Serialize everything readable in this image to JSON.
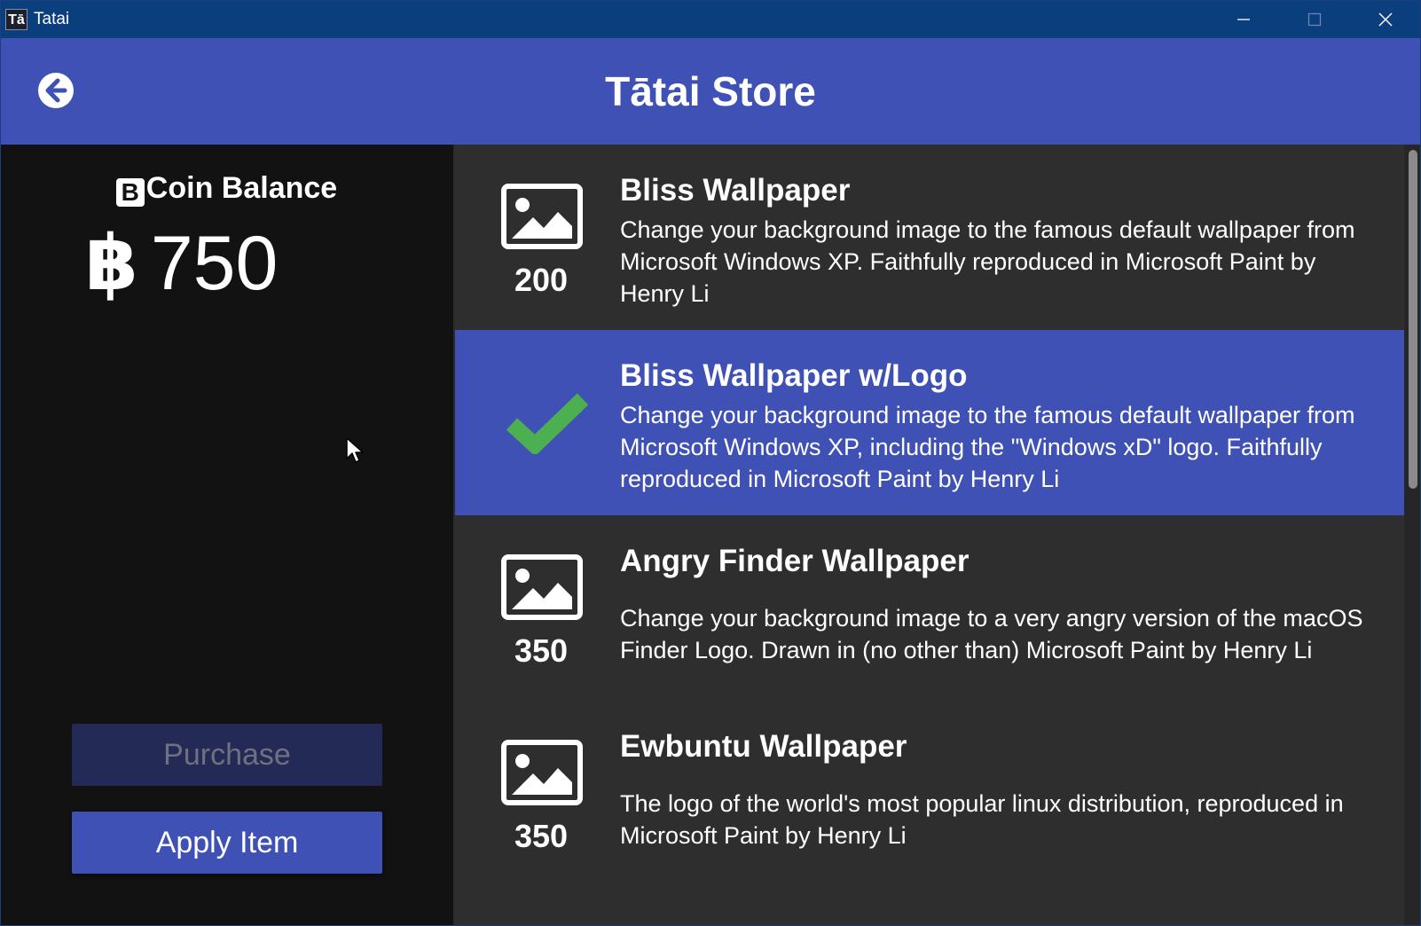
{
  "window": {
    "app_icon_text": "Tā",
    "title": "Tatai",
    "controls": [
      "minimize",
      "maximize",
      "close"
    ]
  },
  "header": {
    "title": "Tātai Store",
    "back_icon": "arrow-left-circle-icon"
  },
  "balance": {
    "badge": "B",
    "label": "Coin Balance",
    "currency_symbol": "฿",
    "amount": "750"
  },
  "actions": {
    "purchase_label": "Purchase",
    "purchase_enabled": false,
    "apply_label": "Apply Item"
  },
  "items": [
    {
      "title": "Bliss Wallpaper",
      "description": "Change your background image to the famous default wallpaper from Microsoft Windows XP. Faithfully reproduced in Microsoft Paint by Henry Li",
      "price": "200",
      "icon": "image-icon",
      "selected": false
    },
    {
      "title": "Bliss Wallpaper w/Logo",
      "description": "Change your background image to the famous default wallpaper from Microsoft Windows XP, including the \"Windows xD\" logo. Faithfully reproduced in Microsoft Paint by Henry Li",
      "price": "",
      "icon": "check-icon",
      "selected": true
    },
    {
      "title": "Angry Finder Wallpaper",
      "description": "Change your background image to a very angry version of the macOS Finder Logo. Drawn in (no other than) Microsoft Paint by Henry Li",
      "price": "350",
      "icon": "image-icon",
      "selected": false
    },
    {
      "title": "Ewbuntu Wallpaper",
      "description": "The logo of the world's most popular linux distribution, reproduced in Microsoft Paint by Henry Li",
      "price": "350",
      "icon": "image-icon",
      "selected": false
    }
  ],
  "colors": {
    "accent": "#3f51b5",
    "titlebar": "#0b3e7c",
    "check": "#4caf50",
    "panel_dark": "#121212",
    "list_bg": "#2e2e2e"
  }
}
